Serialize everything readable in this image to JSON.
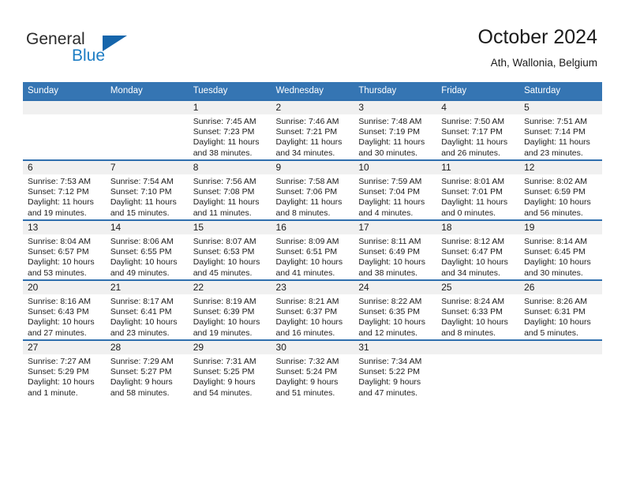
{
  "brand": {
    "name_part1": "General",
    "name_part2": "Blue",
    "logo_icon": "triangle-logo-icon"
  },
  "header": {
    "title": "October 2024",
    "location": "Ath, Wallonia, Belgium"
  },
  "calendar": {
    "weekday_headers": [
      "Sunday",
      "Monday",
      "Tuesday",
      "Wednesday",
      "Thursday",
      "Friday",
      "Saturday"
    ],
    "accent_color": "#3575b3",
    "border_color": "#2f6fae",
    "band_color": "#f0f0f0",
    "weeks": [
      [
        {
          "day": "",
          "sunrise": "",
          "sunset": "",
          "daylight_line1": "",
          "daylight_line2": ""
        },
        {
          "day": "",
          "sunrise": "",
          "sunset": "",
          "daylight_line1": "",
          "daylight_line2": ""
        },
        {
          "day": "1",
          "sunrise": "Sunrise: 7:45 AM",
          "sunset": "Sunset: 7:23 PM",
          "daylight_line1": "Daylight: 11 hours",
          "daylight_line2": "and 38 minutes."
        },
        {
          "day": "2",
          "sunrise": "Sunrise: 7:46 AM",
          "sunset": "Sunset: 7:21 PM",
          "daylight_line1": "Daylight: 11 hours",
          "daylight_line2": "and 34 minutes."
        },
        {
          "day": "3",
          "sunrise": "Sunrise: 7:48 AM",
          "sunset": "Sunset: 7:19 PM",
          "daylight_line1": "Daylight: 11 hours",
          "daylight_line2": "and 30 minutes."
        },
        {
          "day": "4",
          "sunrise": "Sunrise: 7:50 AM",
          "sunset": "Sunset: 7:17 PM",
          "daylight_line1": "Daylight: 11 hours",
          "daylight_line2": "and 26 minutes."
        },
        {
          "day": "5",
          "sunrise": "Sunrise: 7:51 AM",
          "sunset": "Sunset: 7:14 PM",
          "daylight_line1": "Daylight: 11 hours",
          "daylight_line2": "and 23 minutes."
        }
      ],
      [
        {
          "day": "6",
          "sunrise": "Sunrise: 7:53 AM",
          "sunset": "Sunset: 7:12 PM",
          "daylight_line1": "Daylight: 11 hours",
          "daylight_line2": "and 19 minutes."
        },
        {
          "day": "7",
          "sunrise": "Sunrise: 7:54 AM",
          "sunset": "Sunset: 7:10 PM",
          "daylight_line1": "Daylight: 11 hours",
          "daylight_line2": "and 15 minutes."
        },
        {
          "day": "8",
          "sunrise": "Sunrise: 7:56 AM",
          "sunset": "Sunset: 7:08 PM",
          "daylight_line1": "Daylight: 11 hours",
          "daylight_line2": "and 11 minutes."
        },
        {
          "day": "9",
          "sunrise": "Sunrise: 7:58 AM",
          "sunset": "Sunset: 7:06 PM",
          "daylight_line1": "Daylight: 11 hours",
          "daylight_line2": "and 8 minutes."
        },
        {
          "day": "10",
          "sunrise": "Sunrise: 7:59 AM",
          "sunset": "Sunset: 7:04 PM",
          "daylight_line1": "Daylight: 11 hours",
          "daylight_line2": "and 4 minutes."
        },
        {
          "day": "11",
          "sunrise": "Sunrise: 8:01 AM",
          "sunset": "Sunset: 7:01 PM",
          "daylight_line1": "Daylight: 11 hours",
          "daylight_line2": "and 0 minutes."
        },
        {
          "day": "12",
          "sunrise": "Sunrise: 8:02 AM",
          "sunset": "Sunset: 6:59 PM",
          "daylight_line1": "Daylight: 10 hours",
          "daylight_line2": "and 56 minutes."
        }
      ],
      [
        {
          "day": "13",
          "sunrise": "Sunrise: 8:04 AM",
          "sunset": "Sunset: 6:57 PM",
          "daylight_line1": "Daylight: 10 hours",
          "daylight_line2": "and 53 minutes."
        },
        {
          "day": "14",
          "sunrise": "Sunrise: 8:06 AM",
          "sunset": "Sunset: 6:55 PM",
          "daylight_line1": "Daylight: 10 hours",
          "daylight_line2": "and 49 minutes."
        },
        {
          "day": "15",
          "sunrise": "Sunrise: 8:07 AM",
          "sunset": "Sunset: 6:53 PM",
          "daylight_line1": "Daylight: 10 hours",
          "daylight_line2": "and 45 minutes."
        },
        {
          "day": "16",
          "sunrise": "Sunrise: 8:09 AM",
          "sunset": "Sunset: 6:51 PM",
          "daylight_line1": "Daylight: 10 hours",
          "daylight_line2": "and 41 minutes."
        },
        {
          "day": "17",
          "sunrise": "Sunrise: 8:11 AM",
          "sunset": "Sunset: 6:49 PM",
          "daylight_line1": "Daylight: 10 hours",
          "daylight_line2": "and 38 minutes."
        },
        {
          "day": "18",
          "sunrise": "Sunrise: 8:12 AM",
          "sunset": "Sunset: 6:47 PM",
          "daylight_line1": "Daylight: 10 hours",
          "daylight_line2": "and 34 minutes."
        },
        {
          "day": "19",
          "sunrise": "Sunrise: 8:14 AM",
          "sunset": "Sunset: 6:45 PM",
          "daylight_line1": "Daylight: 10 hours",
          "daylight_line2": "and 30 minutes."
        }
      ],
      [
        {
          "day": "20",
          "sunrise": "Sunrise: 8:16 AM",
          "sunset": "Sunset: 6:43 PM",
          "daylight_line1": "Daylight: 10 hours",
          "daylight_line2": "and 27 minutes."
        },
        {
          "day": "21",
          "sunrise": "Sunrise: 8:17 AM",
          "sunset": "Sunset: 6:41 PM",
          "daylight_line1": "Daylight: 10 hours",
          "daylight_line2": "and 23 minutes."
        },
        {
          "day": "22",
          "sunrise": "Sunrise: 8:19 AM",
          "sunset": "Sunset: 6:39 PM",
          "daylight_line1": "Daylight: 10 hours",
          "daylight_line2": "and 19 minutes."
        },
        {
          "day": "23",
          "sunrise": "Sunrise: 8:21 AM",
          "sunset": "Sunset: 6:37 PM",
          "daylight_line1": "Daylight: 10 hours",
          "daylight_line2": "and 16 minutes."
        },
        {
          "day": "24",
          "sunrise": "Sunrise: 8:22 AM",
          "sunset": "Sunset: 6:35 PM",
          "daylight_line1": "Daylight: 10 hours",
          "daylight_line2": "and 12 minutes."
        },
        {
          "day": "25",
          "sunrise": "Sunrise: 8:24 AM",
          "sunset": "Sunset: 6:33 PM",
          "daylight_line1": "Daylight: 10 hours",
          "daylight_line2": "and 8 minutes."
        },
        {
          "day": "26",
          "sunrise": "Sunrise: 8:26 AM",
          "sunset": "Sunset: 6:31 PM",
          "daylight_line1": "Daylight: 10 hours",
          "daylight_line2": "and 5 minutes."
        }
      ],
      [
        {
          "day": "27",
          "sunrise": "Sunrise: 7:27 AM",
          "sunset": "Sunset: 5:29 PM",
          "daylight_line1": "Daylight: 10 hours",
          "daylight_line2": "and 1 minute."
        },
        {
          "day": "28",
          "sunrise": "Sunrise: 7:29 AM",
          "sunset": "Sunset: 5:27 PM",
          "daylight_line1": "Daylight: 9 hours",
          "daylight_line2": "and 58 minutes."
        },
        {
          "day": "29",
          "sunrise": "Sunrise: 7:31 AM",
          "sunset": "Sunset: 5:25 PM",
          "daylight_line1": "Daylight: 9 hours",
          "daylight_line2": "and 54 minutes."
        },
        {
          "day": "30",
          "sunrise": "Sunrise: 7:32 AM",
          "sunset": "Sunset: 5:24 PM",
          "daylight_line1": "Daylight: 9 hours",
          "daylight_line2": "and 51 minutes."
        },
        {
          "day": "31",
          "sunrise": "Sunrise: 7:34 AM",
          "sunset": "Sunset: 5:22 PM",
          "daylight_line1": "Daylight: 9 hours",
          "daylight_line2": "and 47 minutes."
        },
        {
          "day": "",
          "sunrise": "",
          "sunset": "",
          "daylight_line1": "",
          "daylight_line2": ""
        },
        {
          "day": "",
          "sunrise": "",
          "sunset": "",
          "daylight_line1": "",
          "daylight_line2": ""
        }
      ]
    ]
  }
}
